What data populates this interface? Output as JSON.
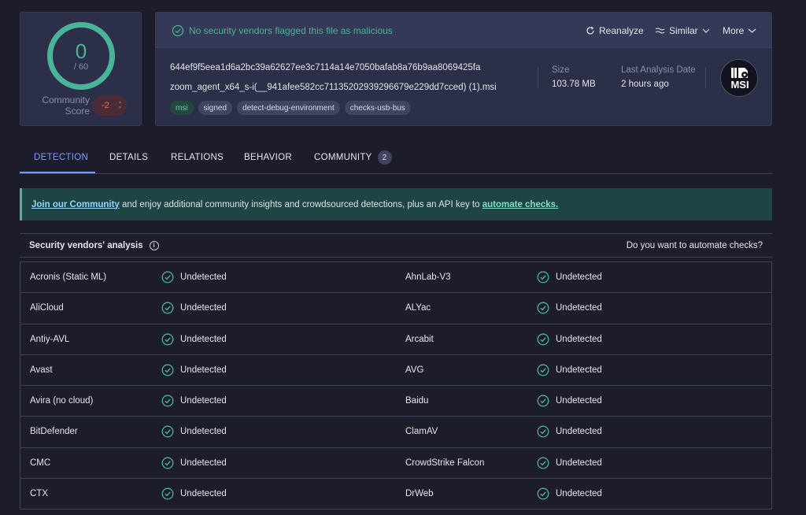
{
  "score": {
    "detections": "0",
    "total": "/ 60",
    "community_label_1": "Community",
    "community_label_2": "Score",
    "community_value": "-2"
  },
  "banner": {
    "text": "No security vendors flagged this file as malicious"
  },
  "actions": {
    "reanalyze": "Reanalyze",
    "similar": "Similar",
    "more": "More"
  },
  "file": {
    "hash": "644ef9f5eea1d6a2bc39a62627ee3c7114a14e7050bafab8a76b9aa8069425fa",
    "name": "zoom_agent_x64_s-i(__941afee582cc71135202939296679e229dd7cced) (1).msi",
    "tags": [
      "msi",
      "signed",
      "detect-debug-environment",
      "checks-usb-bus"
    ],
    "size_label": "Size",
    "size_value": "103.78 MB",
    "date_label": "Last Analysis Date",
    "date_value": "2 hours ago",
    "type_badge": "MSI"
  },
  "tabs": [
    {
      "label": "DETECTION"
    },
    {
      "label": "DETAILS"
    },
    {
      "label": "RELATIONS"
    },
    {
      "label": "BEHAVIOR"
    },
    {
      "label": "COMMUNITY",
      "count": "2"
    }
  ],
  "community_banner": {
    "link1": "Join our Community",
    "mid": " and enjoy additional community insights and crowdsourced detections, plus an API key to ",
    "link2": "automate checks."
  },
  "analysis": {
    "title": "Security vendors' analysis",
    "automate_question": "Do you want to automate checks?"
  },
  "vendors": [
    {
      "left": "Acronis (Static ML)",
      "left_status": "Undetected",
      "right": "AhnLab-V3",
      "right_status": "Undetected"
    },
    {
      "left": "AliCloud",
      "left_status": "Undetected",
      "right": "ALYac",
      "right_status": "Undetected"
    },
    {
      "left": "Antiy-AVL",
      "left_status": "Undetected",
      "right": "Arcabit",
      "right_status": "Undetected"
    },
    {
      "left": "Avast",
      "left_status": "Undetected",
      "right": "AVG",
      "right_status": "Undetected"
    },
    {
      "left": "Avira (no cloud)",
      "left_status": "Undetected",
      "right": "Baidu",
      "right_status": "Undetected"
    },
    {
      "left": "BitDefender",
      "left_status": "Undetected",
      "right": "ClamAV",
      "right_status": "Undetected"
    },
    {
      "left": "CMC",
      "left_status": "Undetected",
      "right": "CrowdStrike Falcon",
      "right_status": "Undetected"
    },
    {
      "left": "CTX",
      "left_status": "Undetected",
      "right": "DrWeb",
      "right_status": "Undetected"
    }
  ],
  "colors": {
    "accent": "#7b9cff",
    "ok": "#4ab49a",
    "bad": "#e66b6b",
    "bg": "#1c1c2b",
    "panel": "#2b2f47"
  }
}
